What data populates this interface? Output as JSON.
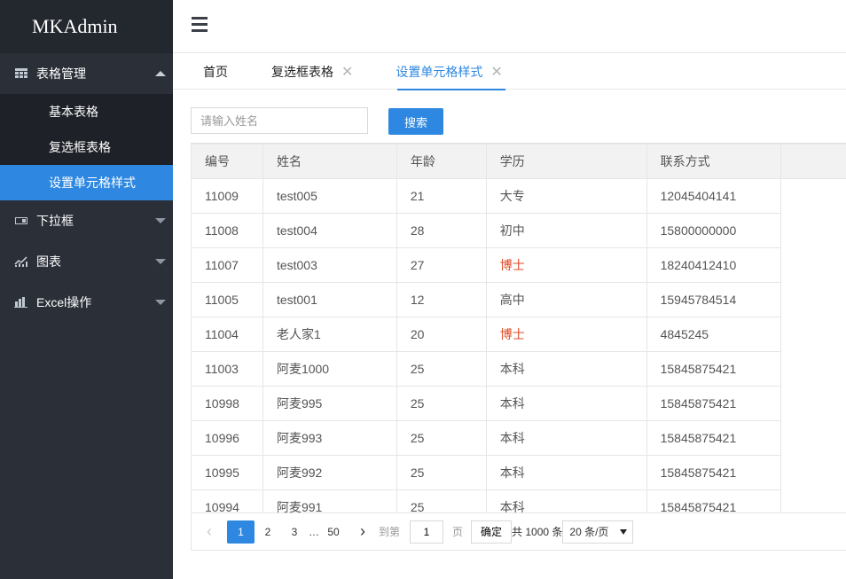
{
  "app": {
    "title": "MKAdmin"
  },
  "sidebar": {
    "groups": [
      {
        "label": "表格管理",
        "icon": "table-icon",
        "expanded": true,
        "items": [
          {
            "label": "基本表格",
            "active": false
          },
          {
            "label": "复选框表格",
            "active": false
          },
          {
            "label": "设置单元格样式",
            "active": true
          }
        ]
      },
      {
        "label": "下拉框",
        "icon": "dropdown-icon",
        "expanded": false
      },
      {
        "label": "图表",
        "icon": "chart-line-icon",
        "expanded": false
      },
      {
        "label": "Excel操作",
        "icon": "bar-chart-icon",
        "expanded": false
      }
    ]
  },
  "header": {
    "menu_icon": "hamburger-icon"
  },
  "tabs": [
    {
      "label": "首页",
      "closable": false,
      "active": false
    },
    {
      "label": "复选框表格",
      "closable": true,
      "active": false
    },
    {
      "label": "设置单元格样式",
      "closable": true,
      "active": true
    }
  ],
  "tab_close_glyph": "✕",
  "search": {
    "placeholder": "请输入姓名",
    "value": "",
    "button_label": "搜索"
  },
  "table": {
    "columns": [
      "编号",
      "姓名",
      "年龄",
      "学历",
      "联系方式"
    ],
    "highlight_color": "#e04b28",
    "rows": [
      {
        "id": "11009",
        "name": "test005",
        "age": "21",
        "edu": "大专",
        "contact": "12045404141",
        "highlight": false
      },
      {
        "id": "11008",
        "name": "test004",
        "age": "28",
        "edu": "初中",
        "contact": "15800000000",
        "highlight": false
      },
      {
        "id": "11007",
        "name": "test003",
        "age": "27",
        "edu": "博士",
        "contact": "18240412410",
        "highlight": true
      },
      {
        "id": "11005",
        "name": "test001",
        "age": "12",
        "edu": "高中",
        "contact": "15945784514",
        "highlight": false
      },
      {
        "id": "11004",
        "name": "老人家1",
        "age": "20",
        "edu": "博士",
        "contact": "4845245",
        "highlight": true
      },
      {
        "id": "11003",
        "name": "阿麦1000",
        "age": "25",
        "edu": "本科",
        "contact": "15845875421",
        "highlight": false
      },
      {
        "id": "10998",
        "name": "阿麦995",
        "age": "25",
        "edu": "本科",
        "contact": "15845875421",
        "highlight": false
      },
      {
        "id": "10996",
        "name": "阿麦993",
        "age": "25",
        "edu": "本科",
        "contact": "15845875421",
        "highlight": false
      },
      {
        "id": "10995",
        "name": "阿麦992",
        "age": "25",
        "edu": "本科",
        "contact": "15845875421",
        "highlight": false
      },
      {
        "id": "10994",
        "name": "阿麦991",
        "age": "25",
        "edu": "本科",
        "contact": "15845875421",
        "highlight": false
      }
    ]
  },
  "pagination": {
    "prev_glyph": "‹",
    "next_glyph": "›",
    "pages": [
      "1",
      "2",
      "3"
    ],
    "current": "1",
    "ellipsis": "…",
    "last": "50",
    "goto_label": "到第",
    "goto_value": "1",
    "page_suffix": "页",
    "confirm_label": "确定",
    "total_text": "共 1000 条",
    "page_size": "20 条/页"
  },
  "colors": {
    "accent": "#2e87e0",
    "sidebar_bg": "#2a2f38",
    "submenu_bg": "#1e2127"
  }
}
